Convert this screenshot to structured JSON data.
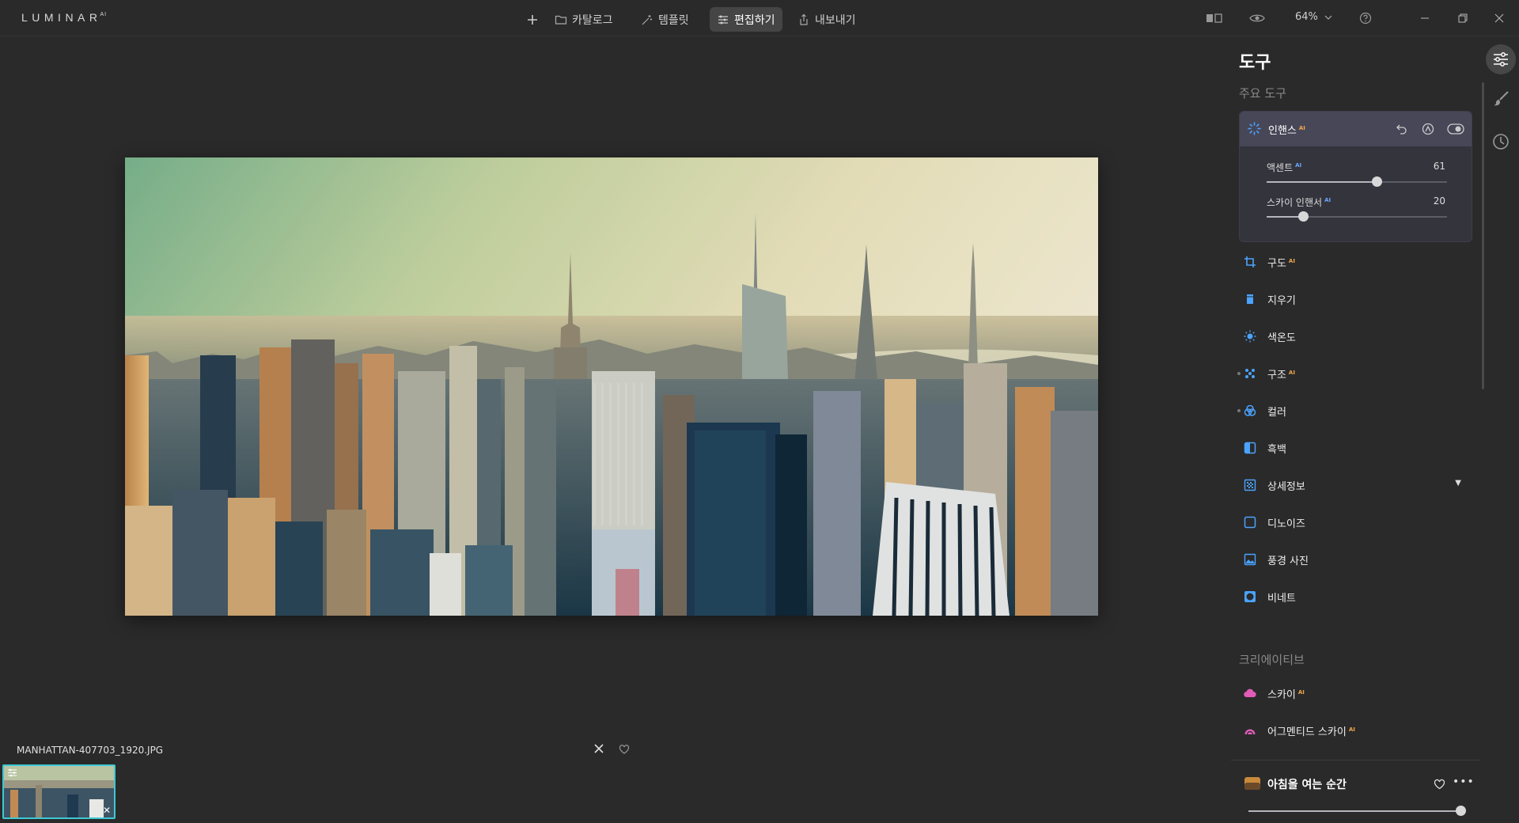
{
  "app": {
    "logo": "LUMINAR",
    "logo_sup": "AI"
  },
  "topbar": {
    "add": "add",
    "catalog": "카탈로그",
    "templates": "템플릿",
    "edit": "편집하기",
    "export": "내보내기",
    "zoom": "64%"
  },
  "filmstrip": {
    "filename": "MANHATTAN-407703_1920.JPG"
  },
  "panel": {
    "title": "도구",
    "essentials_label": "주요 도구",
    "enhance": {
      "label": "인핸스",
      "ai": "AI",
      "sliders": [
        {
          "label": "액센트",
          "ai": "AI",
          "value": "61",
          "level": 61
        },
        {
          "label": "스카이 인핸서",
          "ai": "AI",
          "value": "20",
          "level": 20
        }
      ]
    },
    "tools": [
      {
        "label": "구도",
        "ai": "AI",
        "icon": "crop-icon"
      },
      {
        "label": "지우기",
        "ai": "",
        "icon": "eraser-icon"
      },
      {
        "label": "색온도",
        "ai": "",
        "icon": "sun-icon"
      },
      {
        "label": "구조",
        "ai": "AI",
        "icon": "structure-icon"
      },
      {
        "label": "컬러",
        "ai": "",
        "icon": "color-icon"
      },
      {
        "label": "흑백",
        "ai": "",
        "icon": "bw-icon"
      },
      {
        "label": "상세정보",
        "ai": "",
        "icon": "details-icon"
      },
      {
        "label": "디노이즈",
        "ai": "",
        "icon": "denoise-icon"
      },
      {
        "label": "풍경 사진",
        "ai": "",
        "icon": "landscape-icon"
      },
      {
        "label": "비네트",
        "ai": "",
        "icon": "vignette-icon"
      }
    ],
    "creative_label": "크리에이티브",
    "creative": [
      {
        "label": "스카이",
        "ai": "AI",
        "icon": "sky-icon"
      },
      {
        "label": "어그멘티드 스카이",
        "ai": "AI",
        "icon": "augmented-sky-icon"
      }
    ],
    "preset": {
      "label": "아침을 여는 순간",
      "level": 100
    }
  },
  "colors": {
    "accent": "#3ec8d4",
    "ai_badge": "#f2a64c",
    "tool_icon": "#4aa3ff",
    "sky_icon": "#e05cb8"
  }
}
